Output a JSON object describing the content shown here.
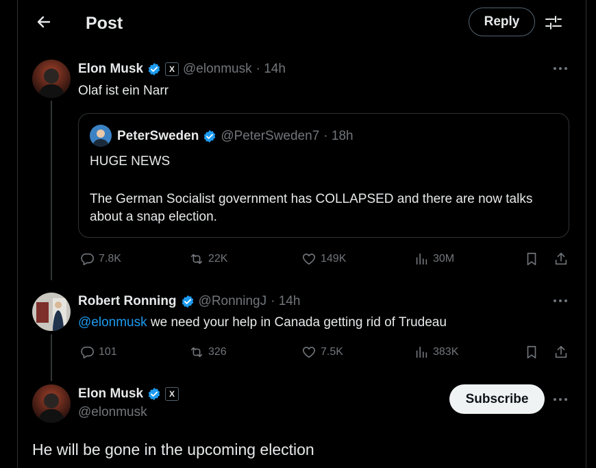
{
  "header": {
    "title": "Post",
    "reply_label": "Reply"
  },
  "post1": {
    "name": "Elon Musk",
    "affiliate": "X",
    "handle": "@elonmusk",
    "time": "· 14h",
    "text": "Olaf ist ein Narr",
    "quote": {
      "name": "PeterSweden",
      "handle": "@PeterSweden7",
      "time": "· 18h",
      "line1": "HUGE NEWS",
      "line2": "The German Socialist government has COLLAPSED and there are now talks about a snap election."
    },
    "stats": {
      "replies": "7.8K",
      "reposts": "22K",
      "likes": "149K",
      "views": "30M"
    }
  },
  "post2": {
    "name": "Robert Ronning",
    "handle": "@RonningJ",
    "time": "· 14h",
    "mention": "@elonmusk",
    "text": " we need your help in Canada getting rid of Trudeau",
    "stats": {
      "replies": "101",
      "reposts": "326",
      "likes": "7.5K",
      "views": "383K"
    }
  },
  "post3": {
    "name": "Elon Musk",
    "affiliate": "X",
    "handle": "@elonmusk",
    "subscribe_label": "Subscribe",
    "text": "He will be gone in the upcoming election"
  },
  "colors": {
    "accent": "#1d9bf0",
    "muted": "#71767b",
    "border": "#2f3336",
    "background": "#000000"
  }
}
